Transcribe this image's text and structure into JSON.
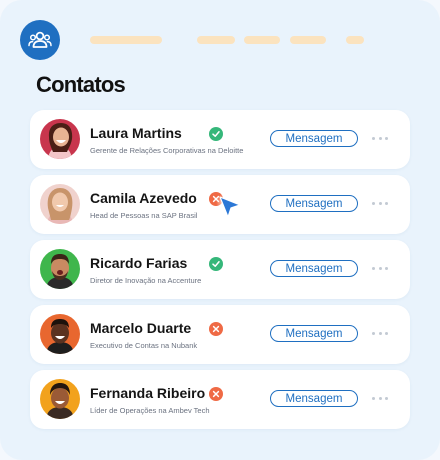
{
  "header": {
    "app_icon": "people-group-icon",
    "title": "Contatos"
  },
  "contacts": [
    {
      "name": "Laura Martins",
      "role": "Gerente de Relações Corporativas na Deloitte",
      "status": "verified",
      "status_icon": "check-icon",
      "action_label": "Mensagem"
    },
    {
      "name": "Camila Azevedo",
      "role": "Head de Pessoas na SAP Brasil",
      "status": "unavailable",
      "status_icon": "close-icon",
      "action_label": "Mensagem"
    },
    {
      "name": "Ricardo Farias",
      "role": "Diretor de Inovação na Accenture",
      "status": "verified",
      "status_icon": "check-icon",
      "action_label": "Mensagem"
    },
    {
      "name": "Marcelo Duarte",
      "role": "Executivo de Contas na Nubank",
      "status": "unavailable",
      "status_icon": "close-icon",
      "action_label": "Mensagem"
    },
    {
      "name": "Fernanda Ribeiro",
      "role": "Líder de Operações na Ambev Tech",
      "status": "unavailable",
      "status_icon": "close-icon",
      "action_label": "Mensagem"
    }
  ],
  "colors": {
    "accent": "#1f6fc1",
    "verified": "#35b77a",
    "unavailable": "#ef6a45",
    "background": "#e9f3fc"
  }
}
